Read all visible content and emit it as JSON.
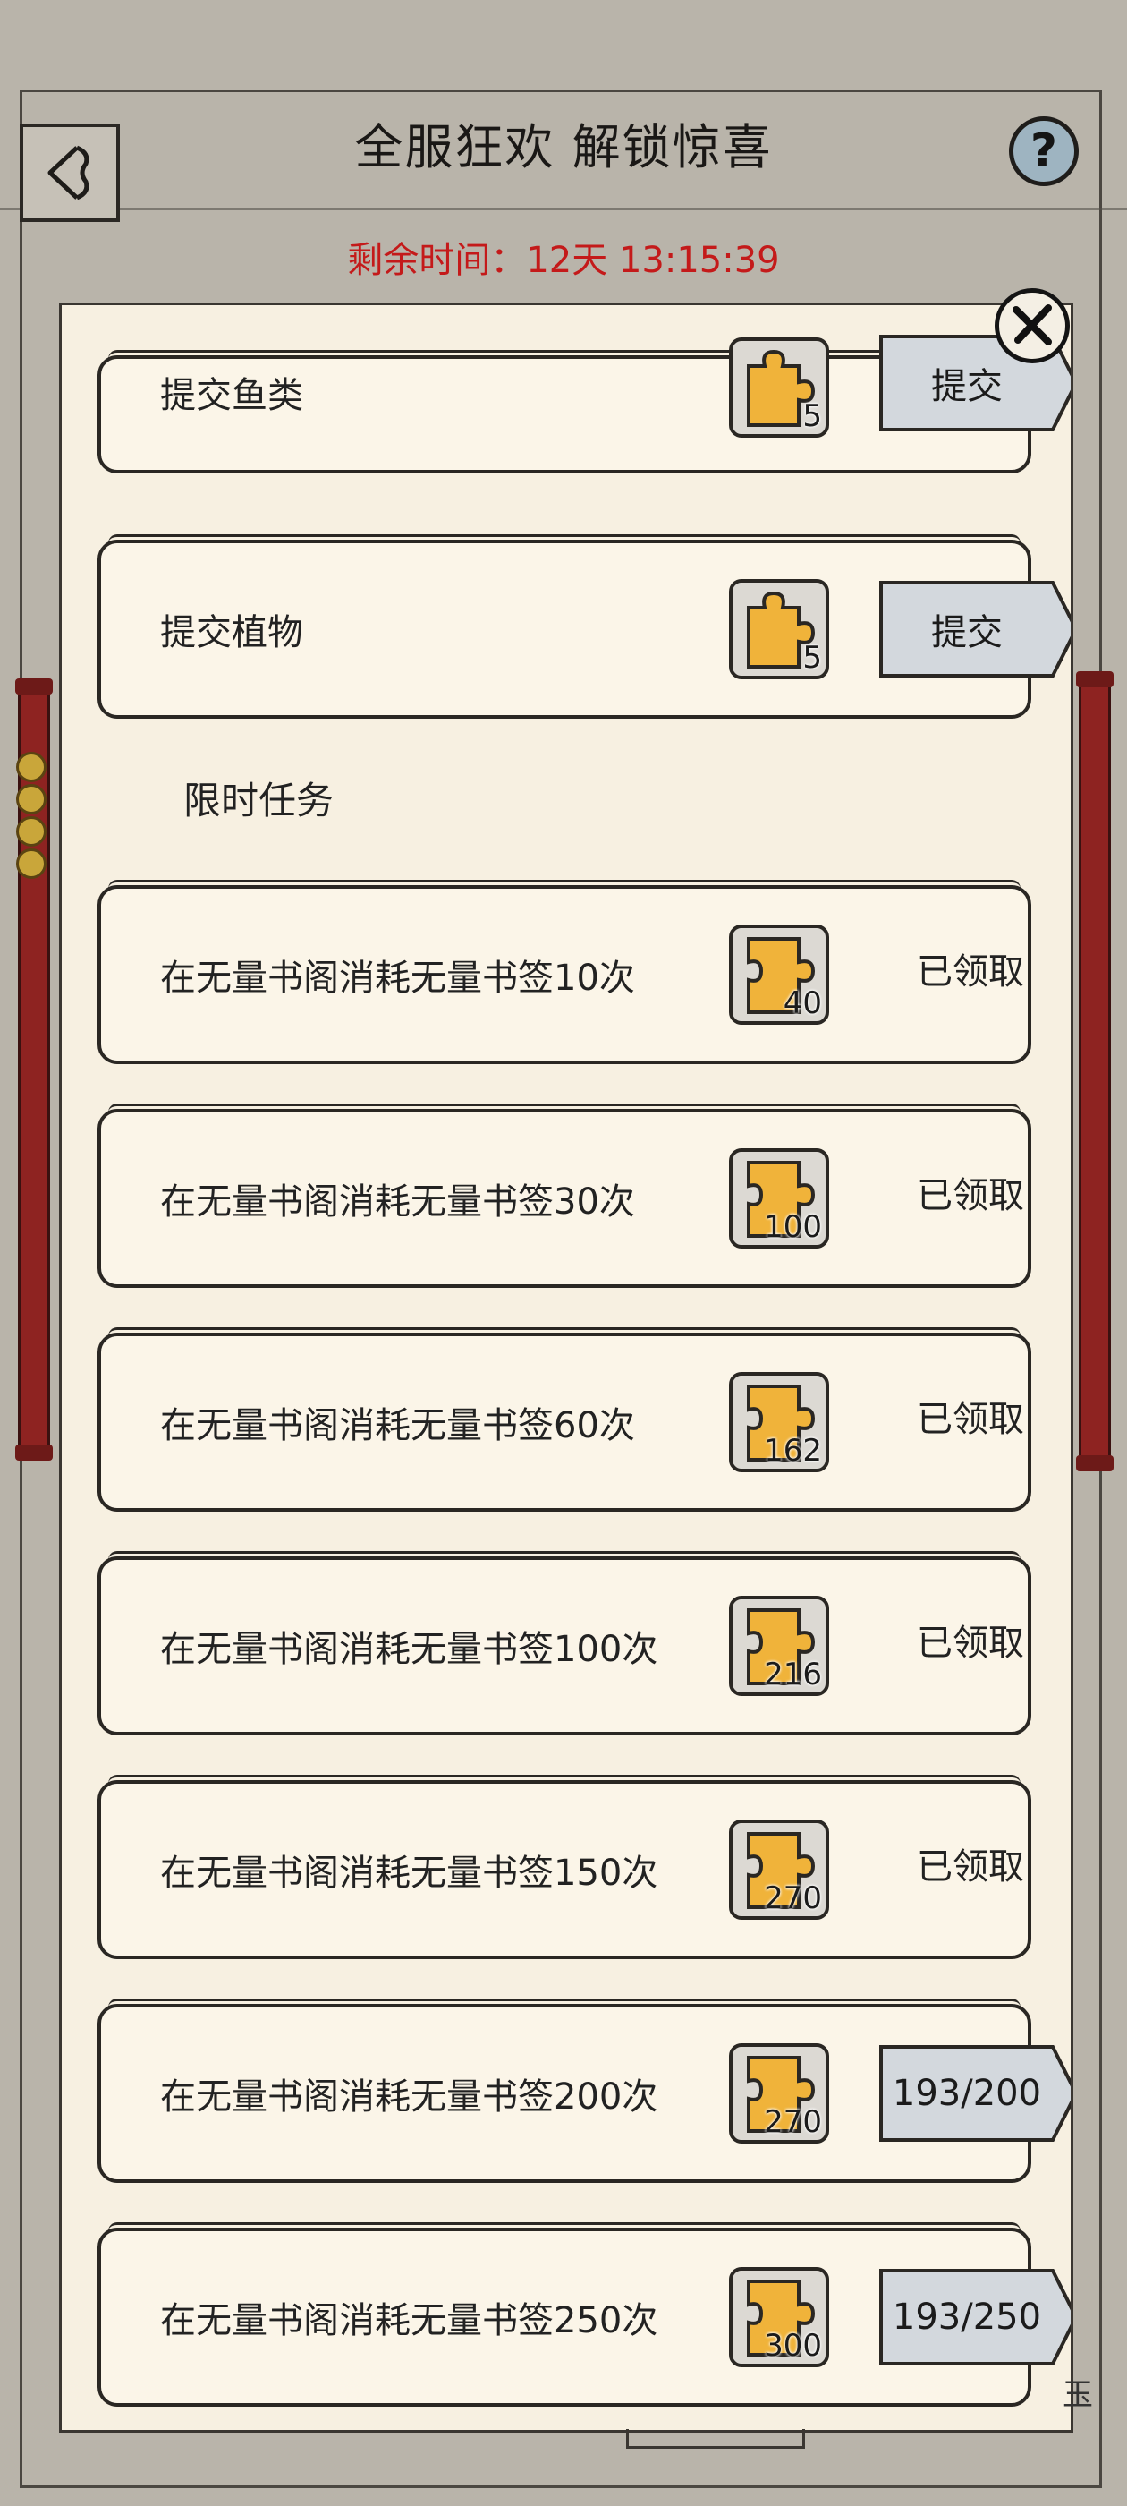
{
  "header": {
    "title": "全服狂欢 解锁惊喜",
    "help": "?",
    "countdown": "剩余时间：12天 13:15:39"
  },
  "colors": {
    "accent_red": "#c41a1a",
    "piece_yellow": "#f0b33a",
    "button_gray": "#d3d8dd",
    "panel_bg": "#f7f0e1"
  },
  "tasks_top": [
    {
      "label": "提交鱼类",
      "reward": "5",
      "button": "提交"
    },
    {
      "label": "提交植物",
      "reward": "5",
      "button": "提交"
    }
  ],
  "section": {
    "title": "限时任务"
  },
  "limited_tasks": [
    {
      "label": "在无量书阁消耗无量书签10次",
      "reward": "40",
      "status": "已领取"
    },
    {
      "label": "在无量书阁消耗无量书签30次",
      "reward": "100",
      "status": "已领取"
    },
    {
      "label": "在无量书阁消耗无量书签60次",
      "reward": "162",
      "status": "已领取"
    },
    {
      "label": "在无量书阁消耗无量书签100次",
      "reward": "216",
      "status": "已领取"
    },
    {
      "label": "在无量书阁消耗无量书签150次",
      "reward": "270",
      "status": "已领取"
    },
    {
      "label": "在无量书阁消耗无量书签200次",
      "reward": "270",
      "progress": "193/200"
    },
    {
      "label": "在无量书阁消耗无量书签250次",
      "reward": "300",
      "progress": "193/250"
    }
  ],
  "corner_text": "玉",
  "icons": {
    "back": "back-arrow-icon",
    "help": "question-icon",
    "close": "close-x-icon",
    "reward": "puzzle-piece-icon"
  }
}
